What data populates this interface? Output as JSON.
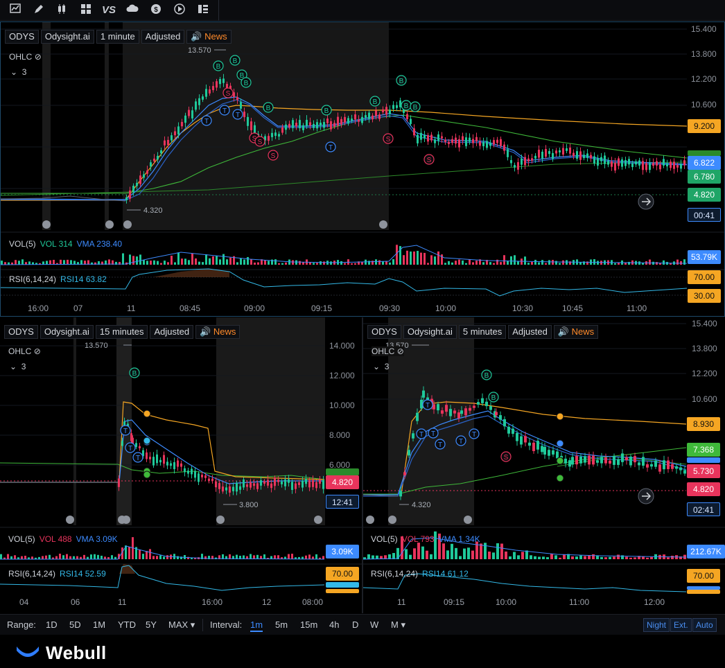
{
  "toolbar": {
    "icons": [
      "chart-line-icon",
      "pencil-icon",
      "candlestick-icon",
      "layout-icon",
      "vs-icon",
      "cloud-icon",
      "dollar-icon",
      "play-icon",
      "list-icon"
    ],
    "vs_label": "VS"
  },
  "top_chart": {
    "symbol": "ODYS",
    "source": "Odysight.ai",
    "interval": "1 minute",
    "adjust": "Adjusted",
    "news": "News",
    "ohlc": "OHLC",
    "collapse": "3",
    "high_label": "13.570",
    "low_label": "4.320",
    "y_ticks": [
      "15.400",
      "13.800",
      "12.200",
      "10.600",
      "9.200",
      "6.822",
      "6.780",
      "4.820",
      "00:41"
    ],
    "y_tick_values": [
      "15.400",
      "13.800",
      "12.200",
      "10.600"
    ],
    "tags": {
      "ma_long": "9.200",
      "price": "6.822",
      "ma_green": "6.780",
      "prev": "4.820",
      "countdown": "00:41"
    },
    "vol": {
      "title": "VOL(5)",
      "vol": "VOL 314",
      "vma": "VMA 238.40",
      "tag": "53.79K"
    },
    "rsi": {
      "title": "RSI(6,14,24)",
      "rsi": "RSI14 63.82",
      "upper": "70.00",
      "lower": "30.00"
    },
    "x_ticks": [
      "16:00",
      "07",
      "11",
      "08:45",
      "09:00",
      "09:15",
      "09:30",
      "10:00",
      "10:30",
      "10:45",
      "11:00"
    ]
  },
  "left_chart": {
    "symbol": "ODYS",
    "source": "Odysight.ai",
    "interval": "15 minutes",
    "adjust": "Adjusted",
    "news": "News",
    "ohlc": "OHLC",
    "collapse": "3",
    "high_label": "13.570",
    "low_label": "3.800",
    "y_ticks": [
      "14.000",
      "12.000",
      "10.000",
      "8.000",
      "6.000"
    ],
    "tags": {
      "price": "4.820",
      "countdown": "12:41"
    },
    "vol": {
      "title": "VOL(5)",
      "vol": "VOL 488",
      "vma": "VMA 3.09K",
      "tag": "3.09K"
    },
    "rsi": {
      "title": "RSI(6,14,24)",
      "rsi": "RSI14 52.59",
      "upper": "70.00"
    },
    "x_ticks": [
      "04",
      "06",
      "11",
      "16:00",
      "12",
      "08:00"
    ]
  },
  "right_chart": {
    "symbol": "ODYS",
    "source": "Odysight.ai",
    "interval": "5 minutes",
    "adjust": "Adjusted",
    "news": "News",
    "ohlc": "OHLC",
    "collapse": "3",
    "high_label": "13.570",
    "low_label": "4.320",
    "y_ticks": [
      "15.400",
      "13.800",
      "12.200",
      "10.600"
    ],
    "tags": {
      "ma_long": "8.930",
      "ma_green": "7.368",
      "price": "5.730",
      "prev": "4.820",
      "countdown": "02:41"
    },
    "vol": {
      "title": "VOL(5)",
      "vol": "VOL 793",
      "vma": "VMA 1.34K",
      "tag": "212.67K"
    },
    "rsi": {
      "title": "RSI(6,14,24)",
      "rsi": "RSI14 61.12",
      "upper": "70.00"
    },
    "x_ticks": [
      "11",
      "09:15",
      "10:00",
      "11:00",
      "12:00"
    ]
  },
  "bottombar": {
    "range_label": "Range:",
    "ranges": [
      "1D",
      "5D",
      "1M",
      "YTD",
      "5Y",
      "MAX ▾"
    ],
    "interval_label": "Interval:",
    "intervals": [
      "1m",
      "5m",
      "15m",
      "4h",
      "D",
      "W",
      "M ▾"
    ],
    "toggles": [
      "Night",
      "Ext.",
      "Auto"
    ]
  },
  "footer": {
    "brand": "Webull"
  },
  "colors": {
    "up": "#1fc99a",
    "down": "#e8345c",
    "ma_orange": "#f5a623",
    "ma_blue": "#3d8bff",
    "ma_green": "#3fb93a",
    "rsi": "#33b9e8"
  }
}
